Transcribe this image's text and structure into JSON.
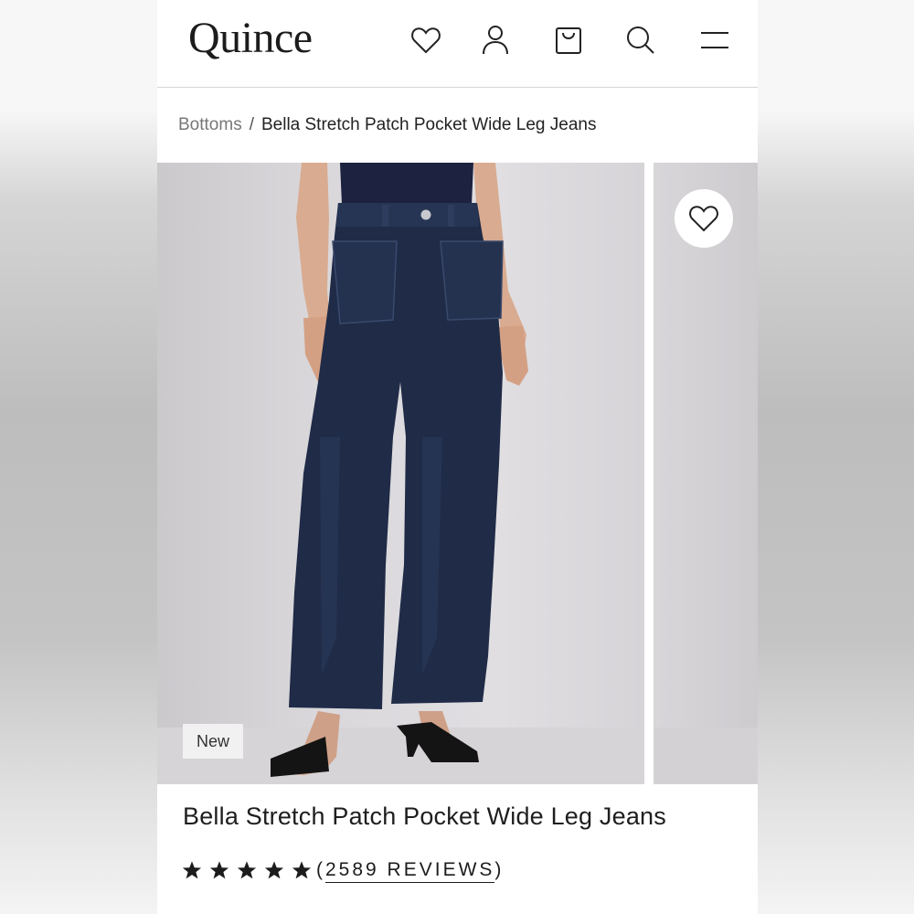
{
  "header": {
    "logo": "Quince",
    "icons": [
      "heart-icon",
      "account-icon",
      "bag-icon",
      "search-icon",
      "menu-icon"
    ]
  },
  "breadcrumb": {
    "parent": "Bottoms",
    "separator": "/",
    "current": "Bella Stretch Patch Pocket Wide Leg Jeans"
  },
  "gallery": {
    "badge": "New",
    "wishlist_icon": "heart-icon"
  },
  "product": {
    "title": "Bella Stretch Patch Pocket Wide Leg Jeans",
    "rating": 5,
    "reviews_open": "(",
    "reviews_label": "2589 REVIEWS",
    "reviews_close": ")"
  },
  "colors": {
    "denim": "#1e2a45",
    "top": "#1c2240",
    "text": "#1c1c1c"
  }
}
